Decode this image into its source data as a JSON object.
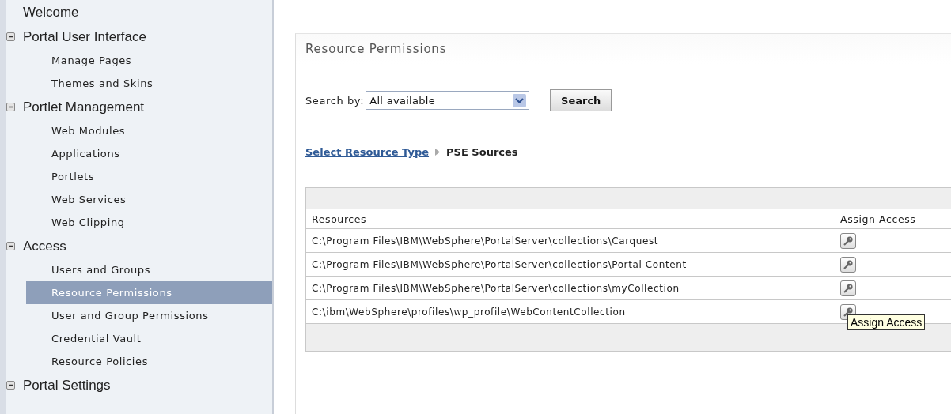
{
  "sidebar": {
    "items": [
      {
        "label": "Welcome",
        "kind": "link",
        "selected": false
      },
      {
        "label": "Portal User Interface",
        "kind": "group",
        "expanded": true,
        "selected": false,
        "children": [
          {
            "label": "Manage Pages",
            "selected": false
          },
          {
            "label": "Themes and Skins",
            "selected": false
          }
        ]
      },
      {
        "label": "Portlet Management",
        "kind": "group",
        "expanded": true,
        "selected": false,
        "children": [
          {
            "label": "Web Modules",
            "selected": false
          },
          {
            "label": "Applications",
            "selected": false
          },
          {
            "label": "Portlets",
            "selected": false
          },
          {
            "label": "Web Services",
            "selected": false
          },
          {
            "label": "Web Clipping",
            "selected": false
          }
        ]
      },
      {
        "label": "Access",
        "kind": "group",
        "expanded": true,
        "selected": false,
        "children": [
          {
            "label": "Users and Groups",
            "selected": false
          },
          {
            "label": "Resource Permissions",
            "selected": true
          },
          {
            "label": "User and Group Permissions",
            "selected": false
          },
          {
            "label": "Credential Vault",
            "selected": false
          },
          {
            "label": "Resource Policies",
            "selected": false
          }
        ]
      },
      {
        "label": "Portal Settings",
        "kind": "group",
        "expanded": true,
        "selected": false
      }
    ]
  },
  "panel": {
    "title": "Resource Permissions",
    "search": {
      "label": "Search by:",
      "value": "All available",
      "button": "Search"
    },
    "breadcrumb": {
      "link": "Select Resource Type",
      "current": "PSE Sources"
    },
    "table": {
      "columns": [
        "Resources",
        "Assign Access"
      ],
      "rows": [
        {
          "resource": "C:\\Program Files\\IBM\\WebSphere\\PortalServer\\collections\\Carquest"
        },
        {
          "resource": "C:\\Program Files\\IBM\\WebSphere\\PortalServer\\collections\\Portal Content"
        },
        {
          "resource": "C:\\Program Files\\IBM\\WebSphere\\PortalServer\\collections\\myCollection"
        },
        {
          "resource": "C:\\ibm\\WebSphere\\profiles\\wp_profile\\WebContentCollection",
          "tooltip": "Assign Access"
        }
      ]
    }
  }
}
